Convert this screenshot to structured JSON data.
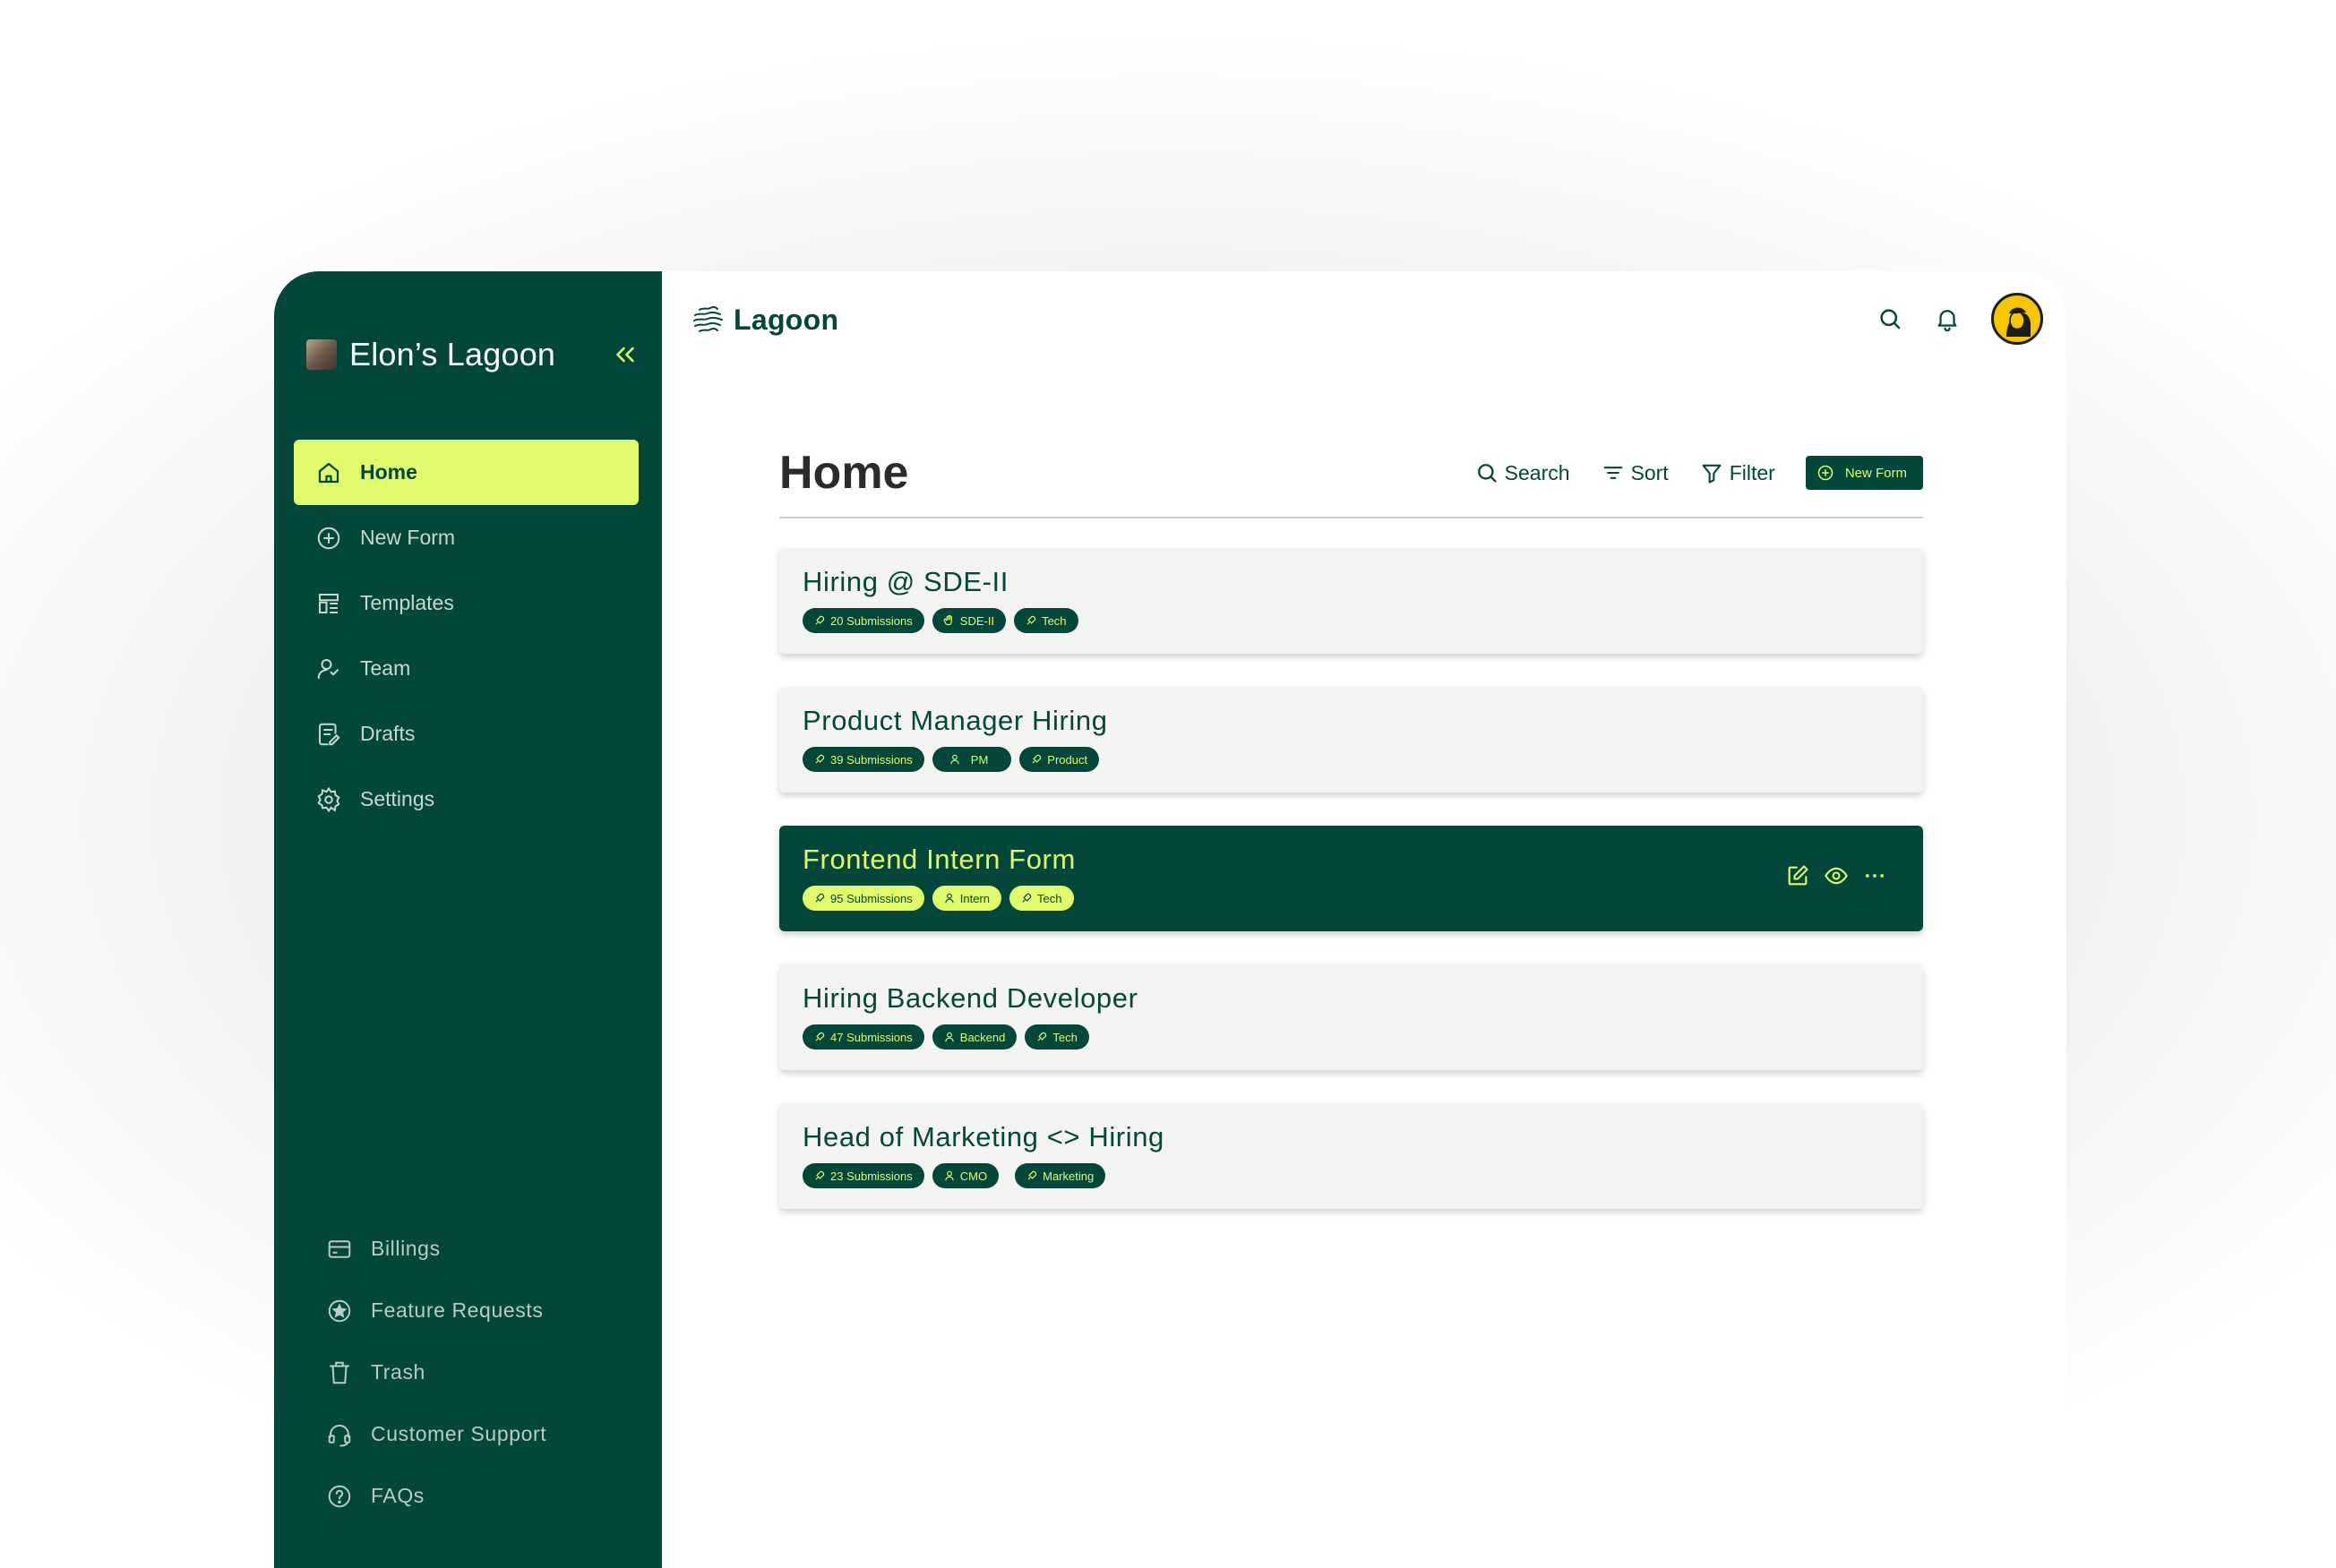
{
  "workspace": {
    "name": "Elon’s Lagoon"
  },
  "sidebar": {
    "items": [
      {
        "label": "Home",
        "icon": "home-icon",
        "active": true
      },
      {
        "label": "New Form",
        "icon": "plus-circle-icon"
      },
      {
        "label": "Templates",
        "icon": "templates-icon"
      },
      {
        "label": "Team",
        "icon": "team-icon"
      },
      {
        "label": "Drafts",
        "icon": "drafts-icon"
      },
      {
        "label": "Settings",
        "icon": "gear-icon"
      }
    ],
    "bottom_items": [
      {
        "label": "Billings",
        "icon": "credit-card-icon"
      },
      {
        "label": "Feature Requests",
        "icon": "star-circle-icon"
      },
      {
        "label": "Trash",
        "icon": "trash-icon"
      },
      {
        "label": "Customer Support",
        "icon": "headset-icon"
      },
      {
        "label": "FAQs",
        "icon": "help-circle-icon"
      }
    ]
  },
  "header": {
    "logo_text": "Lagoon"
  },
  "page": {
    "title": "Home",
    "toolbar": {
      "search": "Search",
      "sort": "Sort",
      "filter": "Filter",
      "new_form": "New Form"
    }
  },
  "forms": [
    {
      "title": "Hiring @ SDE-II",
      "tags": [
        "20 Submissions",
        "SDE-II",
        "Tech"
      ],
      "selected": false
    },
    {
      "title": "Product Manager Hiring",
      "tags": [
        "39 Submissions",
        "PM",
        "Product"
      ],
      "selected": false
    },
    {
      "title": "Frontend Intern Form",
      "tags": [
        "95 Submissions",
        "Intern",
        "Tech"
      ],
      "selected": true
    },
    {
      "title": "Hiring Backend Developer",
      "tags": [
        "47 Submissions",
        "Backend",
        "Tech"
      ],
      "selected": false
    },
    {
      "title": "Head of Marketing <> Hiring",
      "tags": [
        "23 Submissions",
        "CMO",
        "Marketing"
      ],
      "selected": false
    }
  ],
  "colors": {
    "primary": "#02473a",
    "accent": "#e0fa6b",
    "card": "#f3f3f1"
  }
}
